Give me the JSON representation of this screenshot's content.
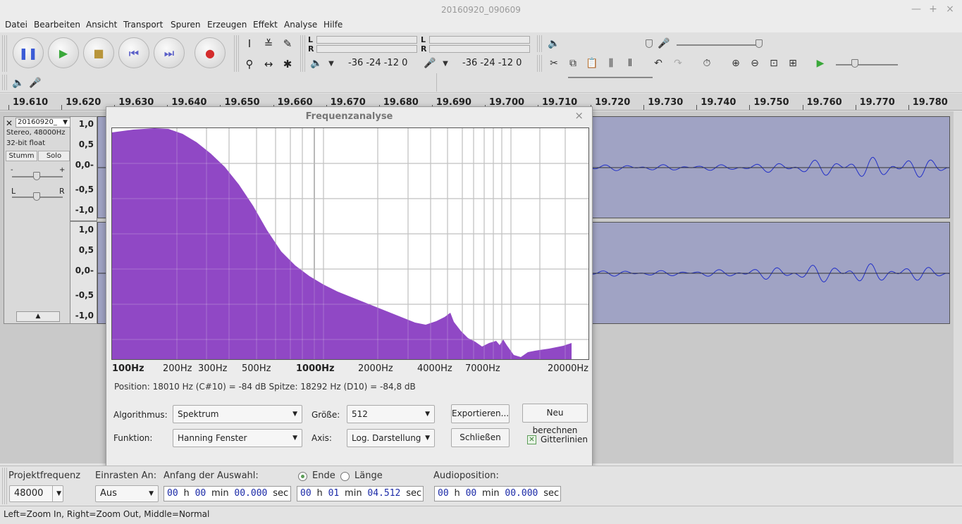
{
  "window": {
    "title": "20160920_090609"
  },
  "menu": [
    "Datei",
    "Bearbeiten",
    "Ansicht",
    "Transport",
    "Spuren",
    "Erzeugen",
    "Effekt",
    "Analyse",
    "Hilfe"
  ],
  "meters": {
    "record_L": "L",
    "record_R": "R",
    "play_L": "L",
    "play_R": "R",
    "record_scale": "-36  -24  -12   0",
    "play_scale": "-36  -24  -12   0"
  },
  "timeline": [
    "19.610",
    "19.620",
    "19.630",
    "19.640",
    "19.650",
    "19.660",
    "19.670",
    "19.680",
    "19.690",
    "19.700",
    "19.710",
    "19.720",
    "19.730",
    "19.740",
    "19.750",
    "19.760",
    "19.770",
    "19.780"
  ],
  "track": {
    "name": "20160920_",
    "format": "Stereo, 48000Hz",
    "bits": "32-bit float",
    "mute": "Stumm",
    "solo": "Solo",
    "gain_minus": "-",
    "gain_plus": "+",
    "pan_L": "L",
    "pan_R": "R",
    "ruler": [
      "1,0",
      "0,5",
      "0,0-",
      "-0,5",
      "-1,0",
      "1,0",
      "0,5",
      "0,0-",
      "-0,5",
      "-1,0"
    ]
  },
  "dialog": {
    "title": "Frequenzanalyse",
    "freq_labels": [
      "100Hz",
      "200Hz",
      "300Hz",
      "500Hz",
      "1000Hz",
      "2000Hz",
      "4000Hz",
      "7000Hz",
      "20000Hz"
    ],
    "position_info": "Position: 18010 Hz (C#10) = -84 dB   Spitze: 18292 Hz (D10) = -84,8 dB",
    "algorithm_label": "Algorithmus:",
    "algorithm_value": "Spektrum",
    "size_label": "Größe:",
    "size_value": "512",
    "function_label": "Funktion:",
    "function_value": "Hanning Fenster",
    "axis_label": "Axis:",
    "axis_value": "Log. Darstellung",
    "export_button": "Exportieren...",
    "recalc_button": "Neu berechnen",
    "close_button": "Schließen",
    "grid_label": "Gitterlinien",
    "grid_checked": true,
    "fill_color": "#8a3ec2"
  },
  "selection": {
    "project_rate_label": "Projektfrequenz",
    "project_rate_value": "48000",
    "snap_label": "Einrasten An:",
    "snap_value": "Aus",
    "start_label": "Anfang der Auswahl:",
    "end_label": "Ende",
    "length_label": "Länge",
    "audiopos_label": "Audioposition:",
    "start_time": {
      "h": "00",
      "m": "00",
      "s": "00.000"
    },
    "end_time": {
      "h": "00",
      "m": "01",
      "s": "04.512"
    },
    "audio_time": {
      "h": "00",
      "m": "00",
      "s": "00.000"
    },
    "unit_h": "h",
    "unit_m": "min",
    "unit_s": "sec"
  },
  "status": "Left=Zoom In, Right=Zoom Out, Middle=Normal"
}
